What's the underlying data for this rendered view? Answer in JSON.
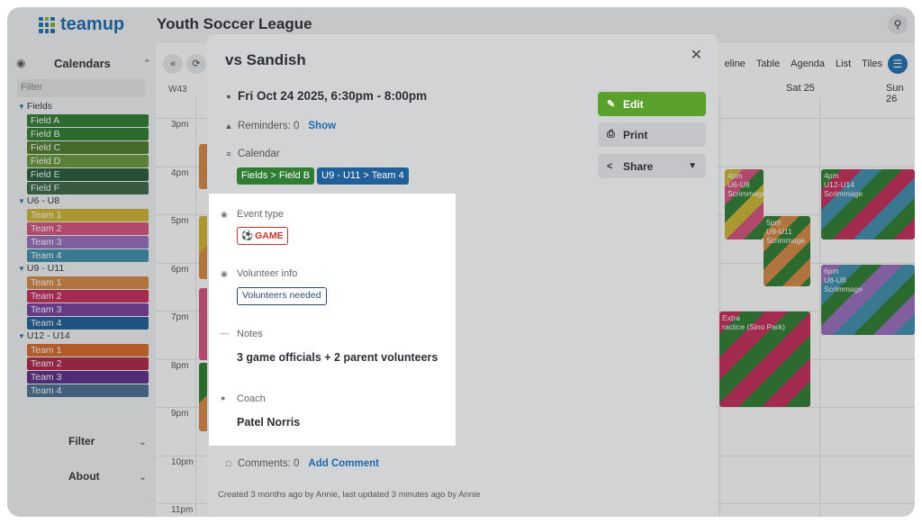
{
  "app": {
    "logo_text": "teamup",
    "calendar_title": "Youth Soccer League"
  },
  "sidebar": {
    "calendars_label": "Calendars",
    "filter_placeholder": "Filter",
    "groups": [
      {
        "label": "Fields",
        "items": [
          {
            "label": "Field A",
            "color": "#2f7d32"
          },
          {
            "label": "Field B",
            "color": "#2e7d32"
          },
          {
            "label": "Field C",
            "color": "#4f7d2a"
          },
          {
            "label": "Field D",
            "color": "#6a9a3a"
          },
          {
            "label": "Field E",
            "color": "#245c3a"
          },
          {
            "label": "Field F",
            "color": "#3b6a44"
          }
        ]
      },
      {
        "label": "U6 - U8",
        "items": [
          {
            "label": "Team 1",
            "color": "#cfb733"
          },
          {
            "label": "Team 2",
            "color": "#d7527f"
          },
          {
            "label": "Team 3",
            "color": "#9a6fc0"
          },
          {
            "label": "Team 4",
            "color": "#3f8fb0"
          }
        ]
      },
      {
        "label": "U9 - U11",
        "items": [
          {
            "label": "Team 1",
            "color": "#d98a46"
          },
          {
            "label": "Team 2",
            "color": "#c62c5c"
          },
          {
            "label": "Team 3",
            "color": "#7a3fa0"
          },
          {
            "label": "Team 4",
            "color": "#1f5f9a"
          }
        ]
      },
      {
        "label": "U12 - U14",
        "items": [
          {
            "label": "Team 1",
            "color": "#d96a2c"
          },
          {
            "label": "Team 2",
            "color": "#b0244a"
          },
          {
            "label": "Team 3",
            "color": "#5c2d8a"
          },
          {
            "label": "Team 4",
            "color": "#4a6f94"
          }
        ]
      }
    ],
    "filter_section": "Filter",
    "about_section": "About"
  },
  "calendar": {
    "week": "W43",
    "views": [
      "eline",
      "Table",
      "Agenda",
      "List",
      "Tiles"
    ],
    "days": [
      "Sat 25",
      "Sun 26"
    ],
    "hours": [
      "3pm",
      "4pm",
      "5pm",
      "6pm",
      "7pm",
      "8pm",
      "9pm",
      "10pm",
      "11pm"
    ],
    "events": [
      {
        "time": "4pm",
        "sub": "U6-U8",
        "title": "Scrimmage"
      },
      {
        "time": "4pm",
        "sub": "U12-U14",
        "title": "Scrimmage"
      },
      {
        "time": "5pm",
        "sub": "U9-U11",
        "title": "Scrimmage"
      },
      {
        "time": "6pm",
        "sub": "U6-U8",
        "title": "Scrimmage"
      },
      {
        "time": "7pm",
        "sub": "Extra",
        "title": "ractice (Sino Park)"
      }
    ]
  },
  "modal": {
    "title": "vs Sandish",
    "datetime": "Fri Oct 24 2025, 6:30pm - 8:00pm",
    "reminders_label": "Reminders: 0",
    "reminders_link": "Show",
    "calendar_label": "Calendar",
    "calendar_chips": [
      {
        "label": "Fields > Field B",
        "color": "#2e7d32"
      },
      {
        "label": "U9 - U11 > Team 4",
        "color": "#1f5f9a"
      }
    ],
    "event_type_label": "Event type",
    "event_type_value": "GAME",
    "volunteer_label": "Volunteer info",
    "volunteer_value": "Volunteers needed",
    "notes_label": "Notes",
    "notes_value": "3 game officials + 2 parent volunteers",
    "coach_label": "Coach",
    "coach_value": "Patel Norris",
    "comments_label": "Comments: 0",
    "comments_link": "Add Comment",
    "footer": "Created 3 months ago by Annie, last updated 3 minutes ago by Annie",
    "buttons": {
      "edit": "Edit",
      "print": "Print",
      "share": "Share"
    },
    "edit_color": "#5aa02c"
  }
}
